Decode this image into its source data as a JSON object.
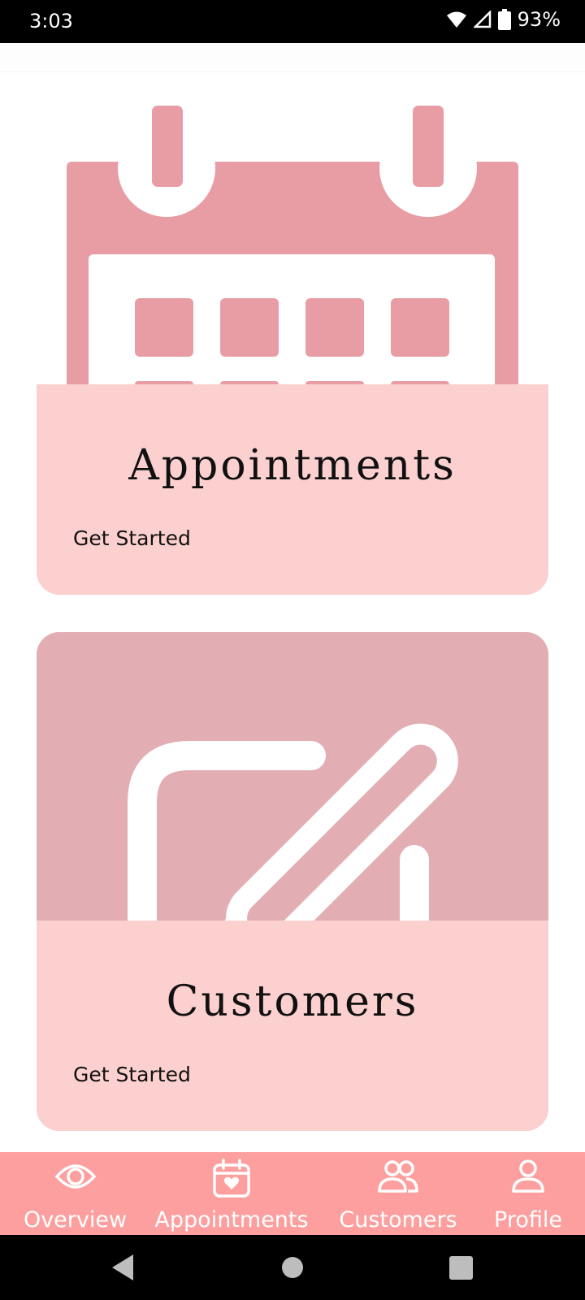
{
  "status_bar": {
    "time": "3:03",
    "battery": "93%"
  },
  "cards": [
    {
      "title": "Appointments",
      "action": "Get Started",
      "image_icon": "calendar-icon"
    },
    {
      "title": "Customers",
      "action": "Get Started",
      "image_icon": "edit-pencil-icon"
    }
  ],
  "bottom_nav": {
    "items": [
      {
        "label": "Overview",
        "icon": "eye-icon"
      },
      {
        "label": "Appointments",
        "icon": "calendar-heart-icon"
      },
      {
        "label": "Customers",
        "icon": "users-icon"
      },
      {
        "label": "Profile",
        "icon": "user-icon"
      }
    ]
  },
  "colors": {
    "card_footer": "#fdd0d0",
    "calendar_pink": "#e89da5",
    "customers_bg": "#e2aeb4",
    "nav_bg": "#fd9f9f"
  }
}
